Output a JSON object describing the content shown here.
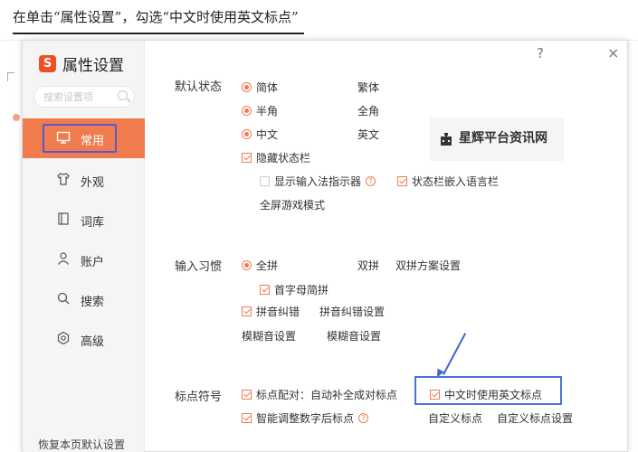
{
  "caption": "在单击“属性设置”，勾选“中文时使用英文标点”",
  "dialog": {
    "title": "属性设置",
    "logo_letter": "S",
    "help_symbol": "?",
    "close_symbol": "×",
    "search_placeholder": "搜索设置项"
  },
  "nav": {
    "items": [
      {
        "label": "常用",
        "icon": "monitor-icon"
      },
      {
        "label": "外观",
        "icon": "tshirt-icon"
      },
      {
        "label": "词库",
        "icon": "book-icon"
      },
      {
        "label": "账户",
        "icon": "user-icon"
      },
      {
        "label": "搜索",
        "icon": "search-icon"
      },
      {
        "label": "高级",
        "icon": "settings-hex-icon"
      }
    ],
    "active": "常用",
    "reset_label": "恢复本页默认设置"
  },
  "default_state": {
    "label": "默认状态",
    "simplified": "简体",
    "traditional": "繁体",
    "halfwidth": "半角",
    "fullwidth": "全角",
    "chinese": "中文",
    "english": "英文",
    "hide_statusbar": "隐藏状态栏",
    "show_indicator": "显示输入法指示器",
    "statusbar_embed": "状态栏嵌入语言栏",
    "faded_option": "全屏游戏模式"
  },
  "input_habit": {
    "label": "输入习惯",
    "full_pinyin": "全拼",
    "double_pinyin": "双拼",
    "double_settings": "双拼方案设置",
    "initials": "首字母简拼",
    "correction": "拼音纠错",
    "correction_settings": "拼音纠错设置",
    "fuzzy_settings": "模糊音设置",
    "fuzzy_settings2": "模糊音设置"
  },
  "punctuation": {
    "label": "标点符号",
    "pairing": "标点配对：自动补全成对标点",
    "english_in_chinese": "中文时使用英文标点",
    "smart_adjust": "智能调整数字后标点",
    "custom": "自定义标点",
    "custom_settings": "自定义标点设置"
  },
  "watermark": "星辉平台资讯网",
  "colors": {
    "accent": "#f07c4e",
    "highlight_purple": "#5a56d6",
    "highlight_blue": "#4a72d8",
    "logo_red": "#f04e23"
  }
}
